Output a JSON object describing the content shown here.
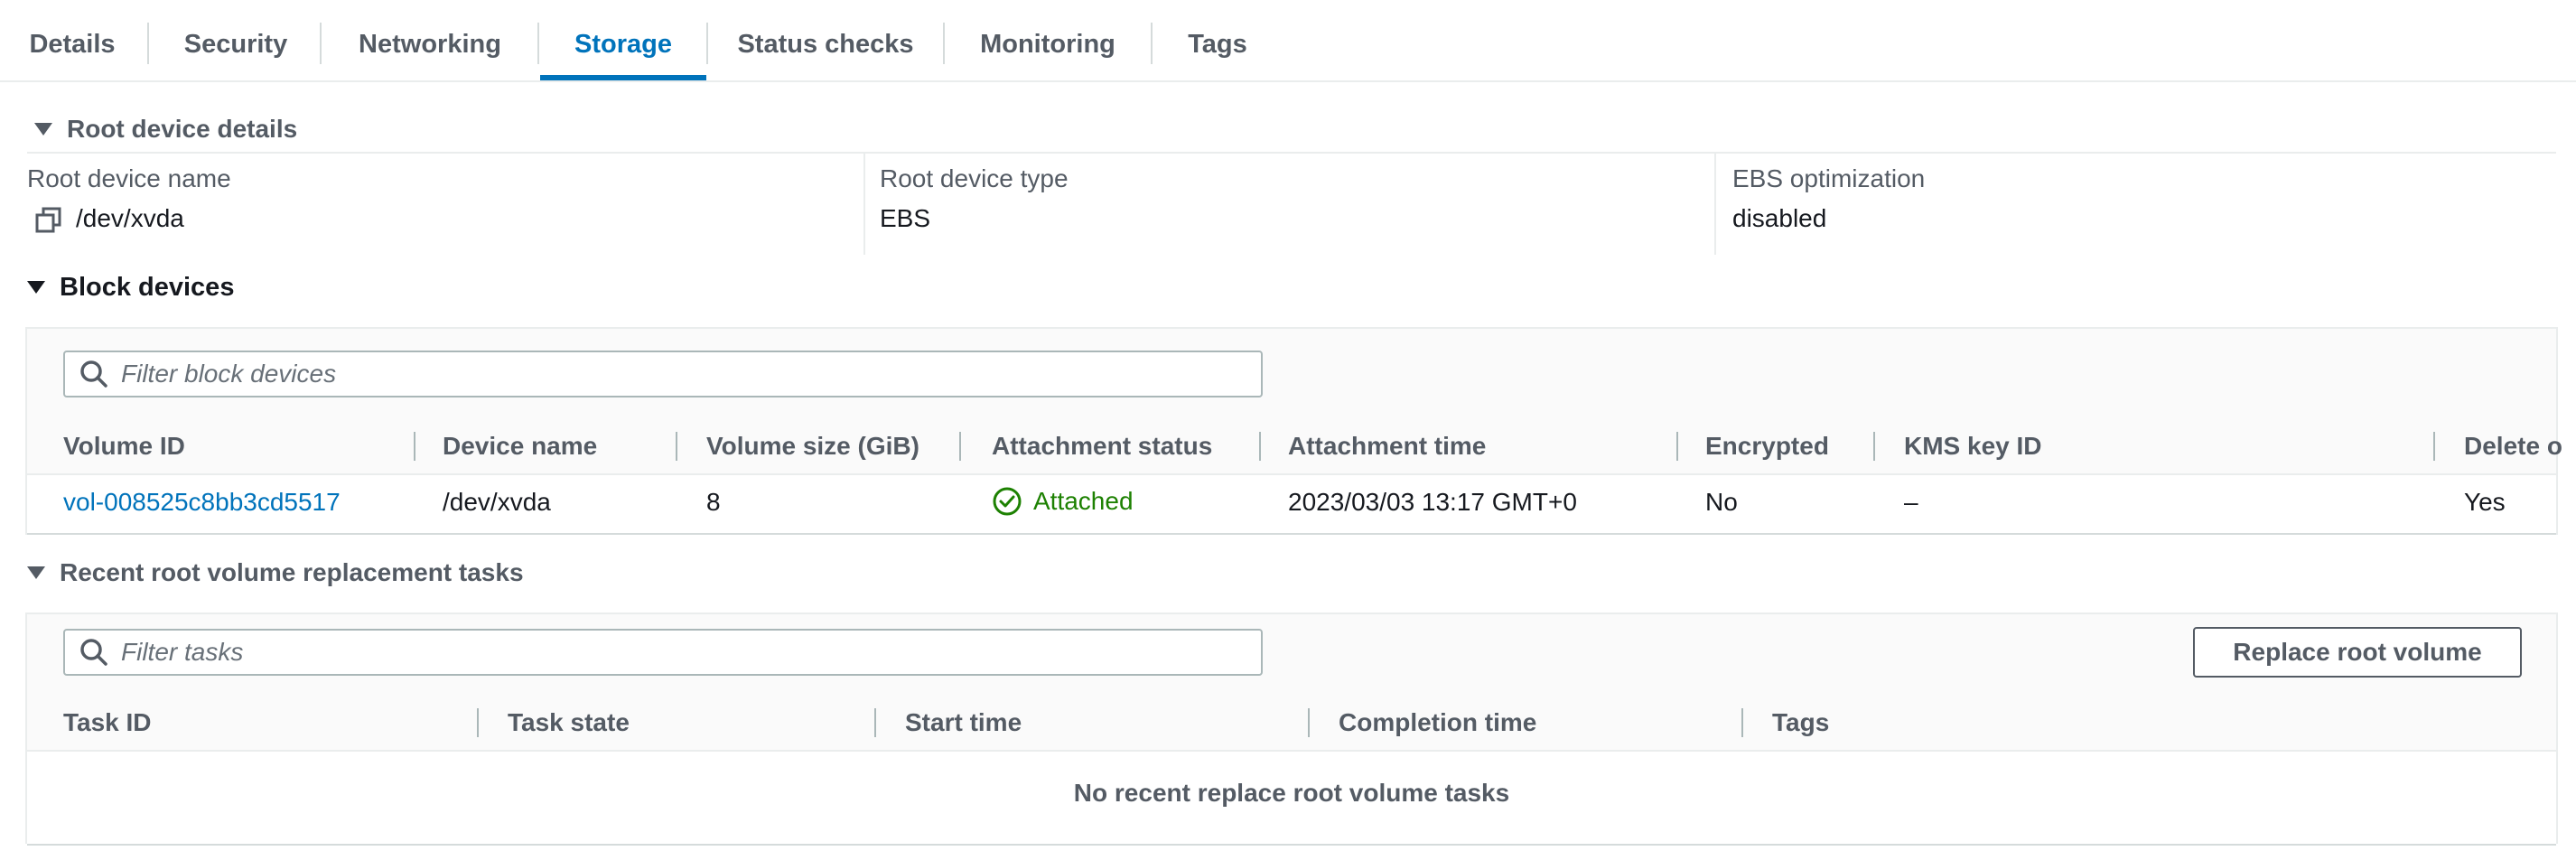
{
  "tabs": [
    {
      "label": "Details"
    },
    {
      "label": "Security"
    },
    {
      "label": "Networking"
    },
    {
      "label": "Storage",
      "active": true
    },
    {
      "label": "Status checks"
    },
    {
      "label": "Monitoring"
    },
    {
      "label": "Tags"
    }
  ],
  "root_device": {
    "title": "Root device details",
    "name_label": "Root device name",
    "name_value": "/dev/xvda",
    "type_label": "Root device type",
    "type_value": "EBS",
    "ebs_label": "EBS optimization",
    "ebs_value": "disabled"
  },
  "block_devices": {
    "title": "Block devices",
    "filter_placeholder": "Filter block devices",
    "columns": [
      "Volume ID",
      "Device name",
      "Volume size (GiB)",
      "Attachment status",
      "Attachment time",
      "Encrypted",
      "KMS key ID",
      "Delete o"
    ],
    "row": {
      "volume_id": "vol-008525c8bb3cd5517",
      "device_name": "/dev/xvda",
      "size": "8",
      "status": "Attached",
      "time": "2023/03/03 13:17 GMT+0",
      "encrypted": "No",
      "kms": "–",
      "delete": "Yes"
    }
  },
  "replacement": {
    "title": "Recent root volume replacement tasks",
    "filter_placeholder": "Filter tasks",
    "button": "Replace root volume",
    "columns": [
      "Task ID",
      "Task state",
      "Start time",
      "Completion time",
      "Tags"
    ],
    "empty": "No recent replace root volume tasks"
  },
  "colors": {
    "accent": "#0073bb",
    "success": "#1d8102"
  }
}
